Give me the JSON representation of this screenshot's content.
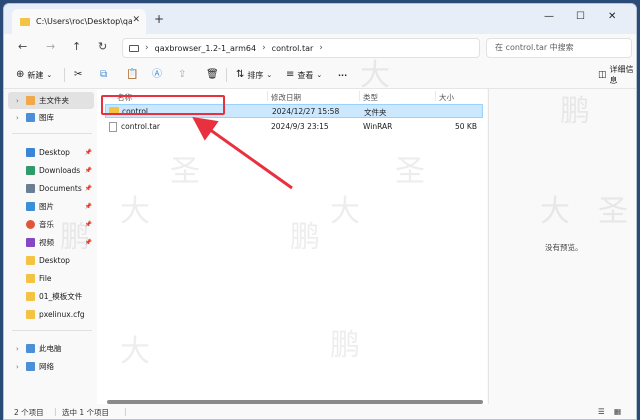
{
  "window": {
    "tab_title": "C:\\Users\\roc\\Desktop\\qaxbrow",
    "new_tab": "+",
    "minimize": "—",
    "maximize": "☐",
    "close": "✕"
  },
  "nav": {
    "back": "←",
    "forward": "→",
    "up": "↑",
    "refresh": "↻",
    "breadcrumb": [
      "qaxbrowser_1.2-1_arm64",
      "control.tar"
    ],
    "search_placeholder": "在 control.tar 中搜索"
  },
  "toolbar": {
    "new_label": "新建",
    "sort_label": "排序",
    "view_label": "查看",
    "more_label": "···",
    "details_label": "详细信息"
  },
  "sidebar": {
    "items": [
      {
        "label": "主文件夹",
        "color": "#f0a848"
      },
      {
        "label": "图库",
        "color": "#4a8fd8"
      },
      {
        "label": "Desktop",
        "color": "#3a86d6"
      },
      {
        "label": "Downloads",
        "color": "#2f9a6a"
      },
      {
        "label": "Documents",
        "color": "#6a7f95"
      },
      {
        "label": "图片",
        "color": "#3b8ed8"
      },
      {
        "label": "音乐",
        "color": "#e0563b"
      },
      {
        "label": "视频",
        "color": "#8547c6"
      },
      {
        "label": "Desktop",
        "color": "#f5c342"
      },
      {
        "label": "File",
        "color": "#f5c342"
      },
      {
        "label": "01_模板文件",
        "color": "#f5c342"
      },
      {
        "label": "pxelinux.cfg",
        "color": "#f5c342"
      },
      {
        "label": "此电脑",
        "color": "#4a8fd8"
      },
      {
        "label": "网络",
        "color": "#4a8fd8"
      }
    ]
  },
  "columns": {
    "name": "名称",
    "modified": "修改日期",
    "type": "类型",
    "size": "大小"
  },
  "files": [
    {
      "name": "control",
      "modified": "2024/12/27 15:58",
      "type": "文件夹",
      "size": ""
    },
    {
      "name": "control.tar",
      "modified": "2024/9/3 23:15",
      "type": "WinRAR",
      "size": "50 KB"
    }
  ],
  "preview": {
    "message": "没有预览。"
  },
  "status": {
    "item_count": "2 个项目",
    "selected": "选中 1 个项目"
  },
  "watermark": {
    "chars": [
      "大",
      "圣",
      "鹏"
    ]
  },
  "colors": {
    "accent_red": "#e8303f",
    "selection": "#cce8ff"
  }
}
